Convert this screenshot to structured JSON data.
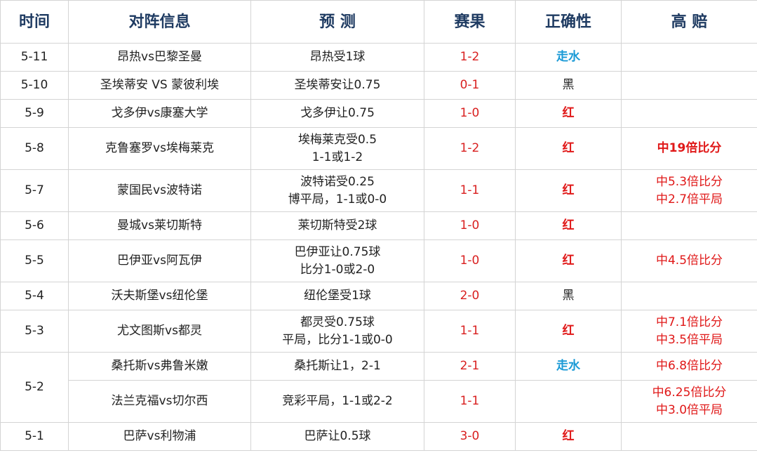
{
  "headers": {
    "time": "时间",
    "match": "对阵信息",
    "prediction": "预 测",
    "score": "赛果",
    "correct": "正确性",
    "odds": "高 赔"
  },
  "rows": [
    {
      "date": "5-11",
      "match": "昂热vs巴黎圣曼",
      "pred1": "昂热受1球",
      "pred2": "",
      "score": "1-2",
      "result": "走水",
      "odds1": "",
      "odds2": ""
    },
    {
      "date": "5-10",
      "match": "圣埃蒂安 VS 蒙彼利埃",
      "pred1": "圣埃蒂安让0.75",
      "pred2": "",
      "score": "0-1",
      "result": "黑",
      "odds1": "",
      "odds2": ""
    },
    {
      "date": "5-9",
      "match": "戈多伊vs康塞大学",
      "pred1": "戈多伊让0.75",
      "pred2": "",
      "score": "1-0",
      "result": "红",
      "odds1": "",
      "odds2": ""
    },
    {
      "date": "5-8",
      "match": "克鲁塞罗vs埃梅莱克",
      "pred1": "埃梅莱克受0.5",
      "pred2": "1-1或1-2",
      "score": "1-2",
      "result": "红",
      "odds1": "中19倍比分",
      "odds2": ""
    },
    {
      "date": "5-7",
      "match": "蒙国民vs波特诺",
      "pred1": "波特诺受0.25",
      "pred2": "博平局，1-1或0-0",
      "score": "1-1",
      "result": "红",
      "odds1": "中5.3倍比分",
      "odds2": "中2.7倍平局"
    },
    {
      "date": "5-6",
      "match": "曼城vs莱切斯特",
      "pred1": "莱切斯特受2球",
      "pred2": "",
      "score": "1-0",
      "result": "红",
      "odds1": "",
      "odds2": ""
    },
    {
      "date": "5-5",
      "match": "巴伊亚vs阿瓦伊",
      "pred1": "巴伊亚让0.75球",
      "pred2": "比分1-0或2-0",
      "score": "1-0",
      "result": "红",
      "odds1": "中4.5倍比分",
      "odds2": ""
    },
    {
      "date": "5-4",
      "match": "沃夫斯堡vs纽伦堡",
      "pred1": "纽伦堡受1球",
      "pred2": "",
      "score": "2-0",
      "result": "黑",
      "odds1": "",
      "odds2": ""
    },
    {
      "date": "5-3",
      "match": "尤文图斯vs都灵",
      "pred1": "都灵受0.75球",
      "pred2": "平局，比分1-1或0-0",
      "score": "1-1",
      "result": "红",
      "odds1": "中7.1倍比分",
      "odds2": "中3.5倍平局"
    },
    {
      "date": "5-2",
      "match": "桑托斯vs弗鲁米嫩",
      "pred1": "桑托斯让1，2-1",
      "pred2": "",
      "score": "2-1",
      "result": "走水",
      "odds1": "中6.8倍比分",
      "odds2": ""
    },
    {
      "date": "",
      "match": "法兰克福vs切尔西",
      "pred1": "竞彩平局，1-1或2-2",
      "pred2": "",
      "score": "1-1",
      "result": "",
      "odds1": "中6.25倍比分",
      "odds2": "中3.0倍平局"
    },
    {
      "date": "5-1",
      "match": "巴萨vs利物浦",
      "pred1": "巴萨让0.5球",
      "pred2": "",
      "score": "3-0",
      "result": "红",
      "odds1": "",
      "odds2": ""
    }
  ]
}
